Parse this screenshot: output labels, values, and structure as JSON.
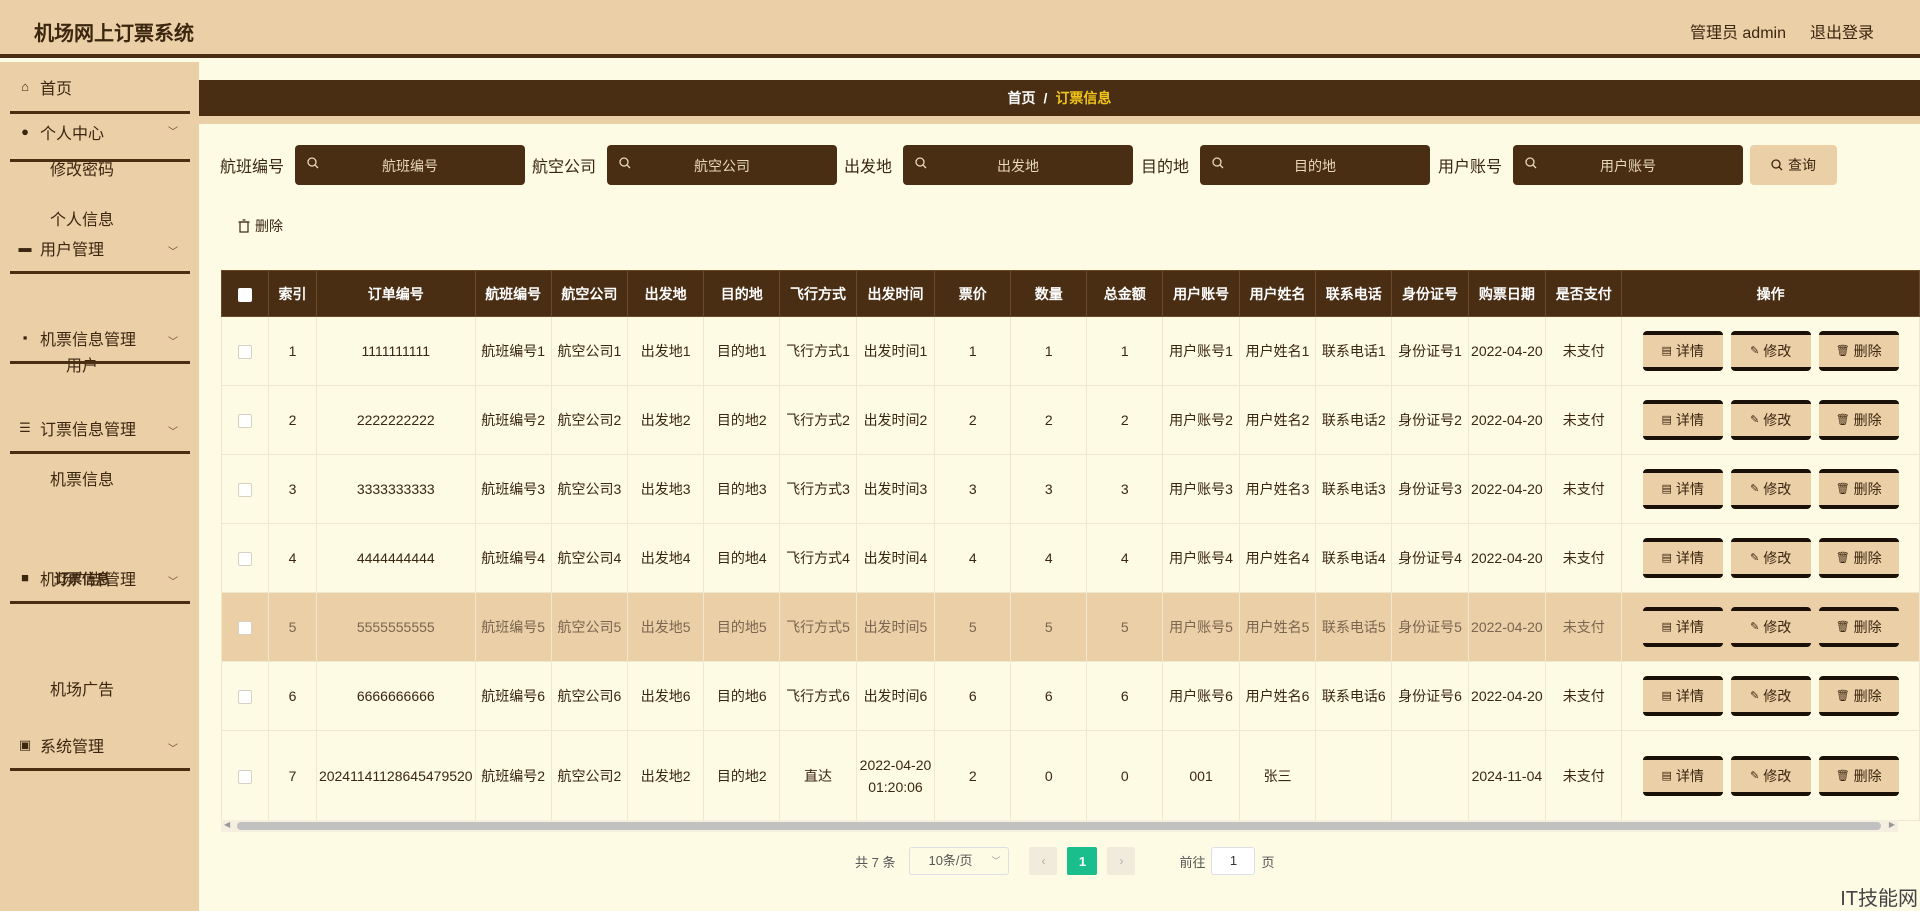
{
  "header": {
    "title": "机场网上订票系统",
    "user": "管理员 admin",
    "logout": "退出登录"
  },
  "sidebar": {
    "home": "首页",
    "personal": "个人中心",
    "change_password": "修改密码",
    "personal_info": "个人信息",
    "user_mgmt": "用户管理",
    "user": "用户",
    "ticket_mgmt": "机票信息管理",
    "ticket_info": "机票信息",
    "order_mgmt": "订票信息管理",
    "order_info": "订票信息",
    "ad_mgmt": "机场广告管理",
    "ad": "机场广告",
    "sys_mgmt": "系统管理"
  },
  "breadcrumb": {
    "home": "首页",
    "sep": "/",
    "current": "订票信息"
  },
  "search": {
    "flight_no_label": "航班编号",
    "flight_no_ph": "航班编号",
    "airline_label": "航空公司",
    "airline_ph": "航空公司",
    "origin_label": "出发地",
    "origin_ph": "出发地",
    "dest_label": "目的地",
    "dest_ph": "目的地",
    "account_label": "用户账号",
    "account_ph": "用户账号",
    "query": "查询"
  },
  "toolbar": {
    "delete": "删除"
  },
  "table": {
    "headers": [
      "索引",
      "订单编号",
      "航班编号",
      "航空公司",
      "出发地",
      "目的地",
      "飞行方式",
      "出发时间",
      "票价",
      "数量",
      "总金额",
      "用户账号",
      "用户姓名",
      "联系电话",
      "身份证号",
      "购票日期",
      "是否支付",
      "操作"
    ],
    "rows": [
      [
        "1",
        "1111111111",
        "航班编号1",
        "航空公司1",
        "出发地1",
        "目的地1",
        "飞行方式1",
        "出发时间1",
        "1",
        "1",
        "1",
        "用户账号1",
        "用户姓名1",
        "联系电话1",
        "身份证号1",
        "2022-04-20",
        "未支付"
      ],
      [
        "2",
        "2222222222",
        "航班编号2",
        "航空公司2",
        "出发地2",
        "目的地2",
        "飞行方式2",
        "出发时间2",
        "2",
        "2",
        "2",
        "用户账号2",
        "用户姓名2",
        "联系电话2",
        "身份证号2",
        "2022-04-20",
        "未支付"
      ],
      [
        "3",
        "3333333333",
        "航班编号3",
        "航空公司3",
        "出发地3",
        "目的地3",
        "飞行方式3",
        "出发时间3",
        "3",
        "3",
        "3",
        "用户账号3",
        "用户姓名3",
        "联系电话3",
        "身份证号3",
        "2022-04-20",
        "未支付"
      ],
      [
        "4",
        "4444444444",
        "航班编号4",
        "航空公司4",
        "出发地4",
        "目的地4",
        "飞行方式4",
        "出发时间4",
        "4",
        "4",
        "4",
        "用户账号4",
        "用户姓名4",
        "联系电话4",
        "身份证号4",
        "2022-04-20",
        "未支付"
      ],
      [
        "5",
        "5555555555",
        "航班编号5",
        "航空公司5",
        "出发地5",
        "目的地5",
        "飞行方式5",
        "出发时间5",
        "5",
        "5",
        "5",
        "用户账号5",
        "用户姓名5",
        "联系电话5",
        "身份证号5",
        "2022-04-20",
        "未支付"
      ],
      [
        "6",
        "6666666666",
        "航班编号6",
        "航空公司6",
        "出发地6",
        "目的地6",
        "飞行方式6",
        "出发时间6",
        "6",
        "6",
        "6",
        "用户账号6",
        "用户姓名6",
        "联系电话6",
        "身份证号6",
        "2022-04-20",
        "未支付"
      ],
      [
        "7",
        "20241141128645479520",
        "航班编号2",
        "航空公司2",
        "出发地2",
        "目的地2",
        "直达",
        "2022-04-20 01:20:06",
        "2",
        "0",
        "0",
        "001",
        "张三",
        "",
        "",
        "2024-11-04",
        "未支付"
      ]
    ],
    "highlight_row": 4,
    "actions": {
      "detail": "详情",
      "edit": "修改",
      "delete": "删除"
    }
  },
  "pagination": {
    "total": "共 7 条",
    "page_size": "10条/页",
    "current": "1",
    "goto": "前往",
    "goto_value": "1",
    "page_unit": "页"
  },
  "watermark": "IT技能网",
  "colors": {
    "dark_brown": "#4a2e14",
    "tan": "#ebcfa6",
    "cream": "#fdfbe4",
    "accent_yellow": "#f0c419",
    "pager_green": "#19be8c"
  }
}
